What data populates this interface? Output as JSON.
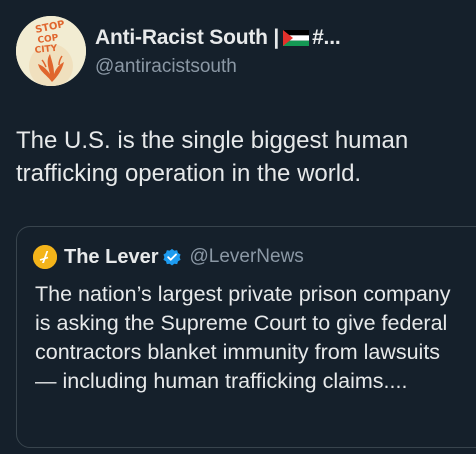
{
  "tweet": {
    "author": {
      "display_name": "Anti-Racist South |",
      "name_suffix": "#...",
      "handle": "@antiracistsouth",
      "avatar_icon": "stop-cop-city-avatar",
      "avatar_text": "STOP COP CITY",
      "flag_icon": "palestine-flag-icon"
    },
    "text": "The U.S. is the single biggest human trafficking operation in the world."
  },
  "quote": {
    "author": {
      "display_name": "The Lever",
      "handle": "@LeverNews",
      "avatar_icon": "the-lever-logo",
      "verified_icon": "verified-badge-icon",
      "verified_color": "#1d9bf0"
    },
    "text": "The nation’s largest private prison company is asking the Supreme Court to give federal contractors blanket immunity from lawsuits — including human trafficking claims...."
  },
  "colors": {
    "background": "#15202b",
    "text_primary": "#e7e9ea",
    "text_secondary": "#8b98a5",
    "border": "#38444d"
  }
}
